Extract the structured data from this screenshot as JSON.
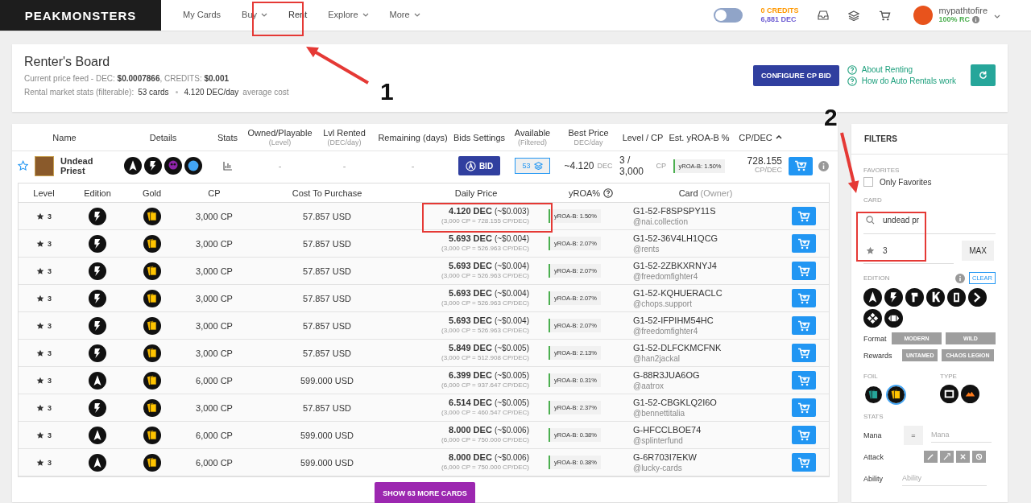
{
  "nav": {
    "logo": "PEAKMONSTERS",
    "items": [
      {
        "label": "My Cards",
        "dropdown": false,
        "selected": false
      },
      {
        "label": "Buy",
        "dropdown": true,
        "selected": false
      },
      {
        "label": "Rent",
        "dropdown": false,
        "selected": true
      },
      {
        "label": "Explore",
        "dropdown": true,
        "selected": false
      },
      {
        "label": "More",
        "dropdown": true,
        "selected": false
      }
    ],
    "dark_mode": {
      "on": false
    },
    "credits": "0 CREDITS",
    "dec": "6,881 DEC",
    "user": {
      "name": "mypathtofire",
      "rc": "100% RC"
    }
  },
  "header": {
    "title": "Renter's Board",
    "price_feed": "Current price feed - DEC: **$0.0007866**, CREDITS: **$0.001**",
    "stats_label": "Rental market stats (filterable):",
    "cards": "53 cards",
    "avg": "4.120 DEC/day",
    "avg_suffix": "average cost",
    "configure_button": "CONFIGURE CP BID",
    "links": [
      "About Renting",
      "How do Auto Rentals work"
    ]
  },
  "table": {
    "columns": [
      {
        "label": "Name",
        "sorted": false
      },
      {
        "label": "Details",
        "sorted": false
      },
      {
        "label": "Stats",
        "sorted": false
      },
      {
        "label": "Owned/Playable",
        "sub": "(Level)",
        "sorted": false
      },
      {
        "label": "Lvl Rented",
        "sub": "(DEC/day)",
        "sorted": false
      },
      {
        "label": "Remaining (days)",
        "sorted": false
      },
      {
        "label": "Bids Settings",
        "sorted": false
      },
      {
        "label": "Available",
        "sub": "(Filtered)",
        "sorted": false
      },
      {
        "label": "Best Price",
        "sub": "DEC/day",
        "sorted": false
      },
      {
        "label": "Level / CP",
        "sorted": false
      },
      {
        "label": "Est. yROA-B %",
        "sorted": false
      },
      {
        "label": "CP/DEC",
        "sorted": true
      }
    ],
    "card": {
      "favorite": false,
      "name": "Undead Priest",
      "owned": "-",
      "lvl_rented": "-",
      "remaining": "-",
      "bid_button": "BID",
      "available": "53",
      "best_price": "~4.120",
      "best_unit": "DEC",
      "level_cp": "3 / 3,000",
      "cp_unit": "CP",
      "yroa": "yROA-B: 1.50%",
      "cp_dec": "728.155",
      "cp_dec_unit": "CP/DEC"
    },
    "listings": {
      "columns": [
        {
          "label": "Level"
        },
        {
          "label": "Edition"
        },
        {
          "label": "Gold"
        },
        {
          "label": "CP"
        },
        {
          "label": "Cost To Purchase"
        },
        {
          "label": "Daily Price"
        },
        {
          "label": "yROA%",
          "help": true
        },
        {
          "label": "Card",
          "sub": "(Owner)"
        }
      ],
      "rows": [
        {
          "level": "3",
          "kind": "beta",
          "cp": "3,000 CP",
          "cost": "57.857 USD",
          "price": "4.120 DEC",
          "usd": "(~$0.003)",
          "detail": "(3,000 CP = 728.155 CP/DEC)",
          "yroa": "yROA-B: 1.50%",
          "card": "G1-52-F8SPSPY11S",
          "owner": "@nai.collection"
        },
        {
          "level": "3",
          "kind": "beta",
          "cp": "3,000 CP",
          "cost": "57.857 USD",
          "price": "5.693 DEC",
          "usd": "(~$0.004)",
          "detail": "(3,000 CP = 526.963 CP/DEC)",
          "yroa": "yROA-B: 2.07%",
          "card": "G1-52-36V4LH1QCG",
          "owner": "@rents"
        },
        {
          "level": "3",
          "kind": "beta",
          "cp": "3,000 CP",
          "cost": "57.857 USD",
          "price": "5.693 DEC",
          "usd": "(~$0.004)",
          "detail": "(3,000 CP = 526.963 CP/DEC)",
          "yroa": "yROA-B: 2.07%",
          "card": "G1-52-2ZBKXRNYJ4",
          "owner": "@freedomfighter4"
        },
        {
          "level": "3",
          "kind": "beta",
          "cp": "3,000 CP",
          "cost": "57.857 USD",
          "price": "5.693 DEC",
          "usd": "(~$0.004)",
          "detail": "(3,000 CP = 526.963 CP/DEC)",
          "yroa": "yROA-B: 2.07%",
          "card": "G1-52-KQHUERACLC",
          "owner": "@chops.support"
        },
        {
          "level": "3",
          "kind": "beta",
          "cp": "3,000 CP",
          "cost": "57.857 USD",
          "price": "5.693 DEC",
          "usd": "(~$0.004)",
          "detail": "(3,000 CP = 526.963 CP/DEC)",
          "yroa": "yROA-B: 2.07%",
          "card": "G1-52-IFPIHM54HC",
          "owner": "@freedomfighter4"
        },
        {
          "level": "3",
          "kind": "beta",
          "cp": "3,000 CP",
          "cost": "57.857 USD",
          "price": "5.849 DEC",
          "usd": "(~$0.005)",
          "detail": "(3,000 CP = 512.908 CP/DEC)",
          "yroa": "yROA-B: 2.13%",
          "card": "G1-52-DLFCKMCFNK",
          "owner": "@han2jackal"
        },
        {
          "level": "3",
          "kind": "alpha",
          "cp": "6,000 CP",
          "cost": "599.000 USD",
          "price": "6.399 DEC",
          "usd": "(~$0.005)",
          "detail": "(6,000 CP = 937.647 CP/DEC)",
          "yroa": "yROA-B: 0.31%",
          "card": "G-88R3JUA6OG",
          "owner": "@aatrox"
        },
        {
          "level": "3",
          "kind": "beta",
          "cp": "3,000 CP",
          "cost": "57.857 USD",
          "price": "6.514 DEC",
          "usd": "(~$0.005)",
          "detail": "(3,000 CP = 460.547 CP/DEC)",
          "yroa": "yROA-B: 2.37%",
          "card": "G1-52-CBGKLQ2I6O",
          "owner": "@bennettitalia"
        },
        {
          "level": "3",
          "kind": "alpha",
          "cp": "6,000 CP",
          "cost": "599.000 USD",
          "price": "8.000 DEC",
          "usd": "(~$0.006)",
          "detail": "(6,000 CP = 750.000 CP/DEC)",
          "yroa": "yROA-B: 0.38%",
          "card": "G-HFCCLBOE74",
          "owner": "@splinterfund"
        },
        {
          "level": "3",
          "kind": "alpha",
          "cp": "6,000 CP",
          "cost": "599.000 USD",
          "price": "8.000 DEC",
          "usd": "(~$0.006)",
          "detail": "(6,000 CP = 750.000 CP/DEC)",
          "yroa": "yROA-B: 0.38%",
          "card": "G-6R703I7EKW",
          "owner": "@lucky-cards"
        }
      ],
      "more_button": "SHOW 63 MORE CARDS"
    }
  },
  "filters": {
    "title": "FILTERS",
    "favorites": {
      "label": "FAVORITES",
      "option": "Only Favorites",
      "checked": false
    },
    "card": {
      "label": "CARD",
      "search": "undead pr",
      "level": "3",
      "max_button": "MAX"
    },
    "edition": {
      "label": "EDITION",
      "clear": "CLEAR"
    },
    "format": {
      "label": "Format",
      "options": [
        "MODERN",
        "WILD"
      ]
    },
    "rewards": {
      "label": "Rewards",
      "options": [
        "UNTAMED",
        "CHAOS LEGION"
      ]
    },
    "foil": {
      "label": "FOIL",
      "options": [
        {
          "kind": "regular",
          "selected": false
        },
        {
          "kind": "gold",
          "selected": true
        }
      ]
    },
    "type": {
      "label": "TYPE"
    },
    "stats": {
      "label": "STATS",
      "mana_label": "Mana",
      "operator": "=",
      "mana_placeholder": "Mana",
      "attack_label": "Attack",
      "ability_label": "Ability",
      "ability_placeholder": "Ability"
    }
  },
  "annotations": [
    {
      "label": "1"
    },
    {
      "label": "2"
    }
  ]
}
